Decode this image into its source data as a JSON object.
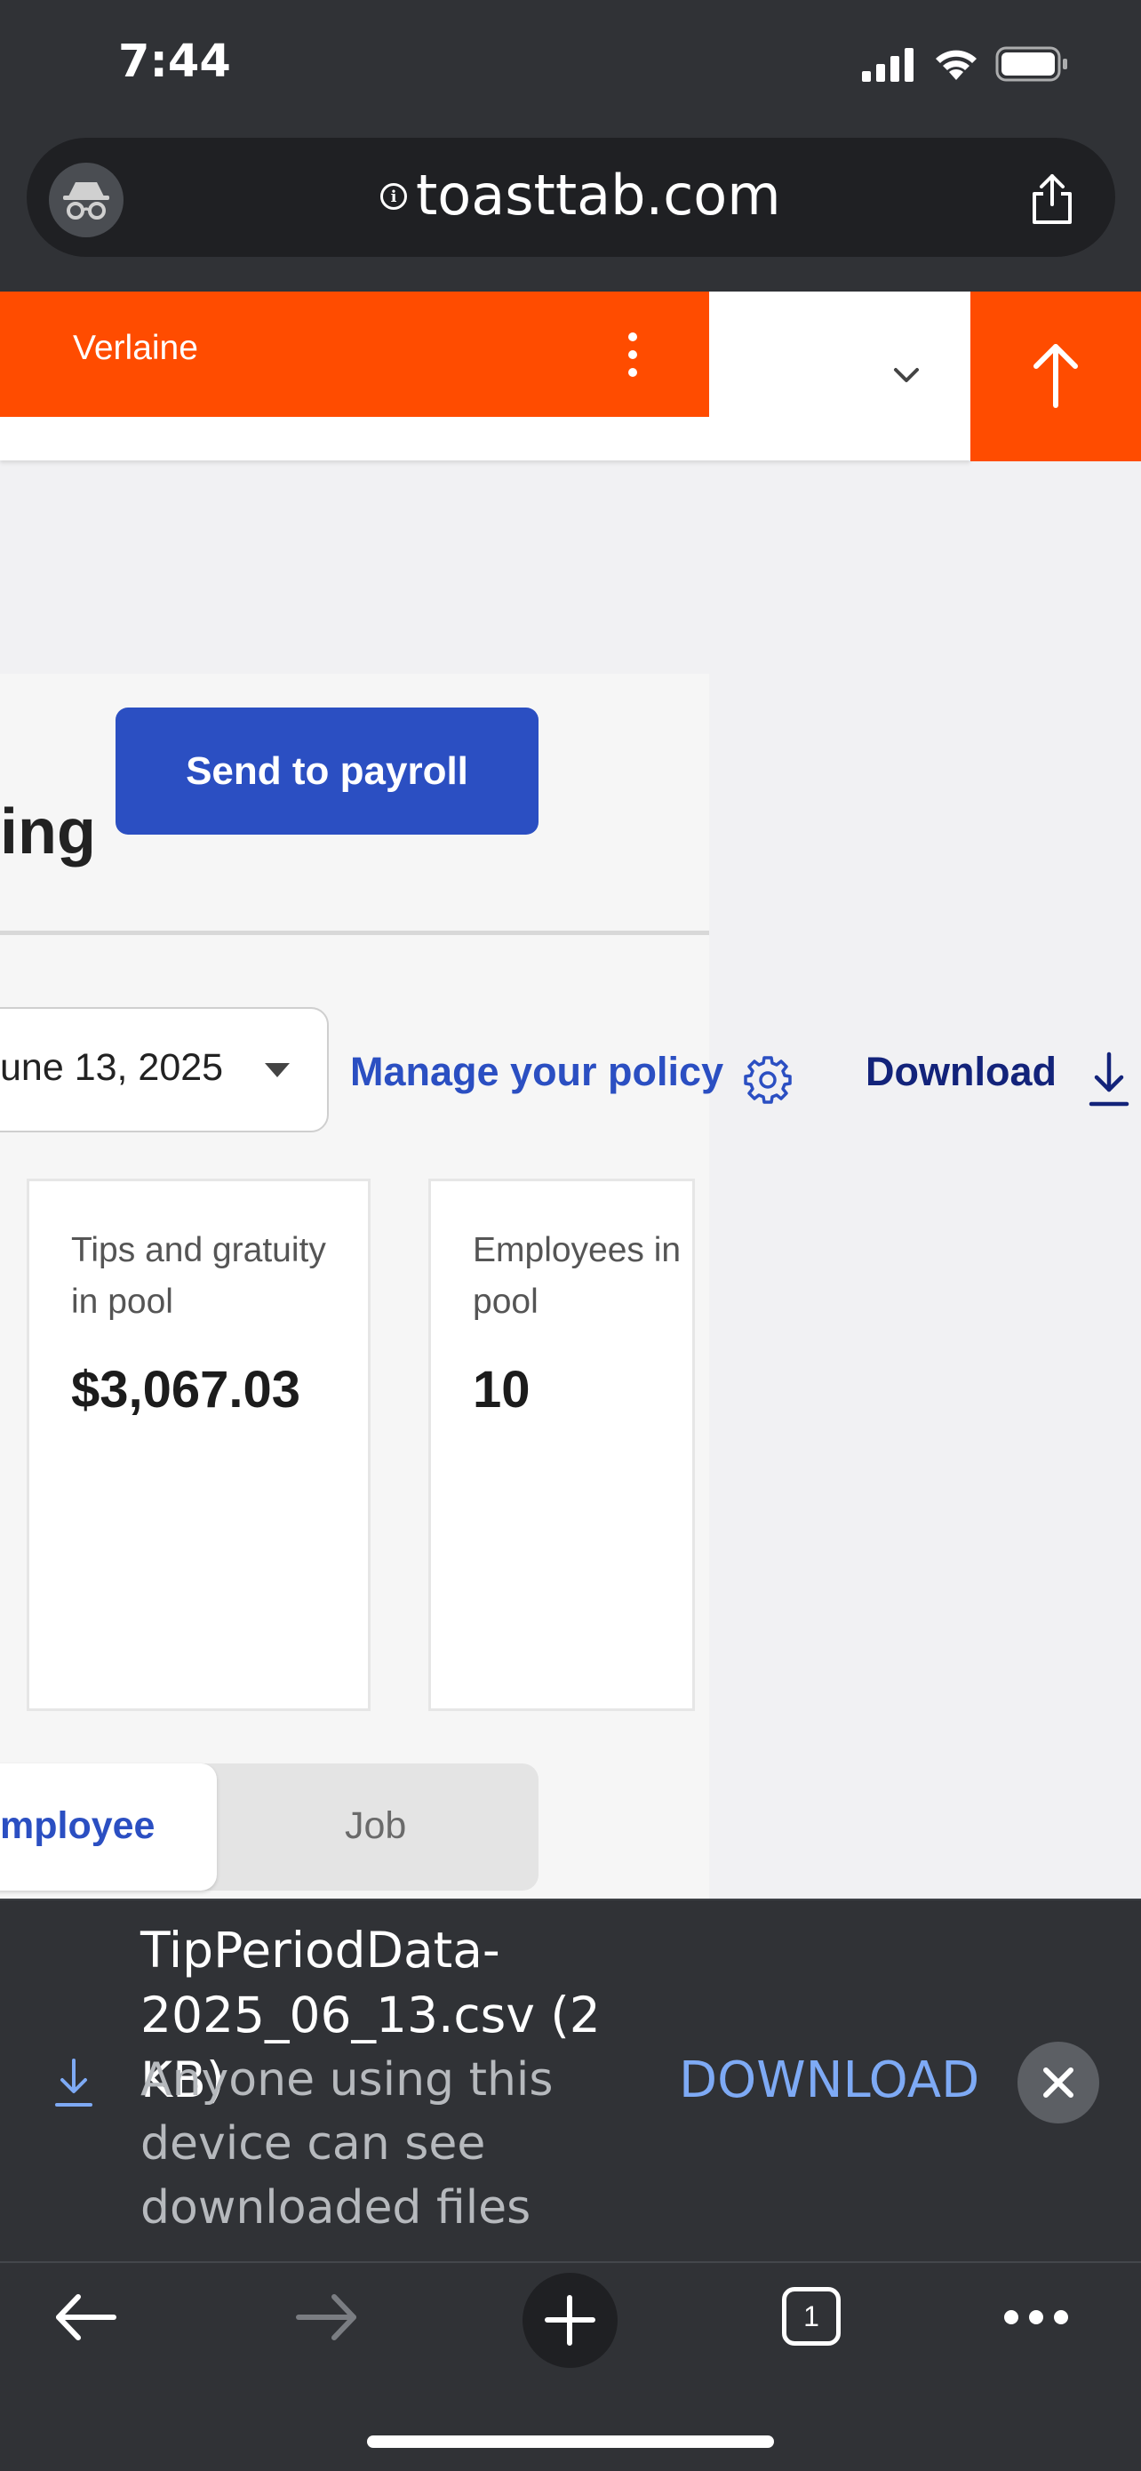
{
  "status_bar": {
    "time": "7:44"
  },
  "browser": {
    "url": "toasttab.com",
    "tab_count": "1"
  },
  "header": {
    "location": "Verlaine"
  },
  "page": {
    "title_partial": "ing",
    "send_to_payroll": "Send to payroll",
    "pay_period": "une 13, 2025",
    "manage_policy": "Manage your policy",
    "download": "Download",
    "stats": {
      "tips_label": "Tips and gratuity in pool",
      "tips_value": "$3,067.03",
      "employees_label": "Employees in pool",
      "employees_value": "10"
    },
    "toggle": {
      "employee": "mployee",
      "job": "Job"
    }
  },
  "download_banner": {
    "file_name": "TipPeriodData-2025_06_13.csv (2 KB)",
    "warning": "Anyone using this device can see downloaded files",
    "action": "DOWNLOAD"
  },
  "colors": {
    "toast_orange": "#ff4c00",
    "primary_blue": "#2b4fc2",
    "dark_blue": "#13237a",
    "chrome_bg": "#303236"
  }
}
